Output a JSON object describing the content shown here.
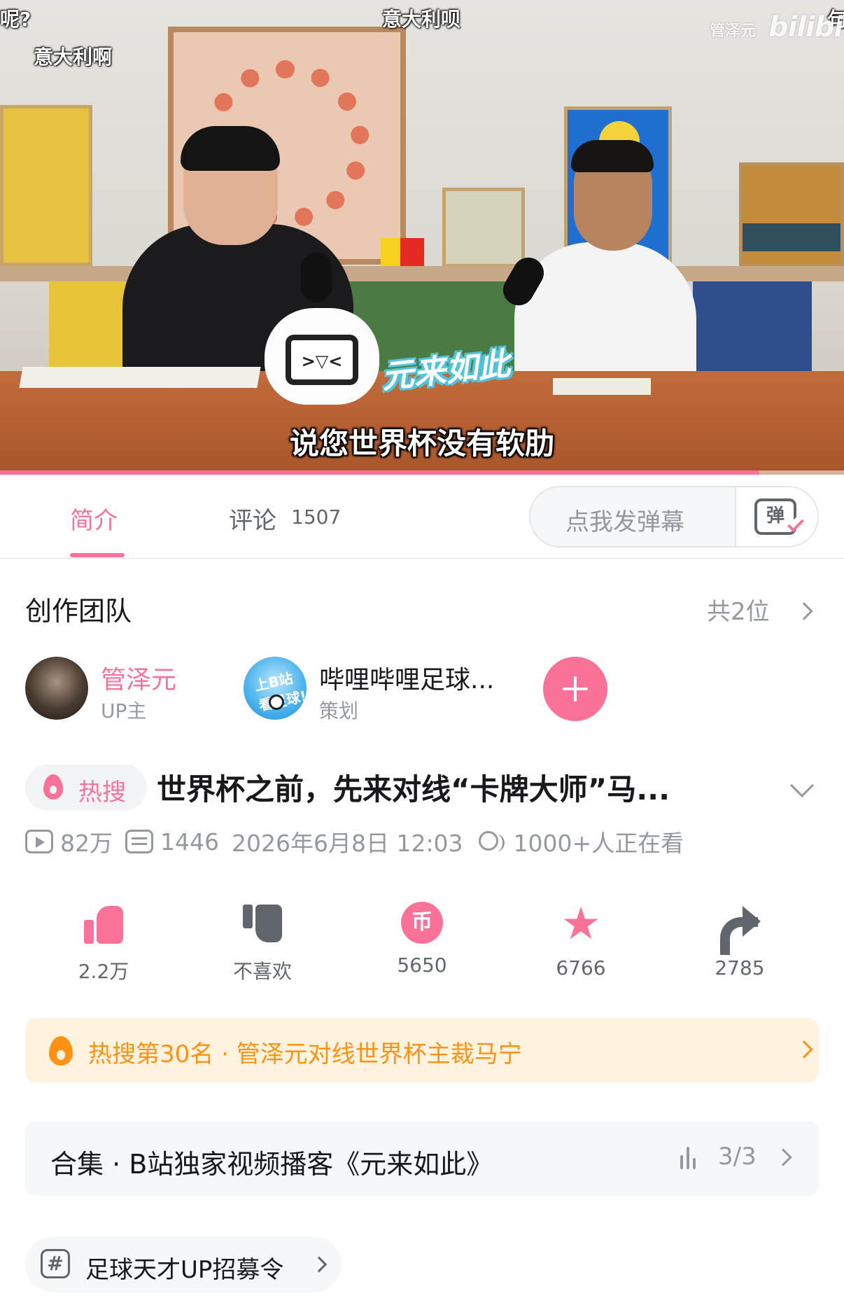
{
  "video": {
    "danmaku": [
      "呢?",
      "意大利呗",
      "意大利啊",
      "句"
    ],
    "subtitle": "说您世界杯没有软肋",
    "watermark_user": "管泽元",
    "watermark_logo": "bilibili",
    "sticker_text": "元来如此",
    "progress": 0.9,
    "colors": {
      "progress": "#fb7299"
    }
  },
  "tabs": {
    "intro_label": "简介",
    "comments_label": "评论",
    "comments_count": "1507",
    "danmaku_placeholder": "点我发弹幕",
    "danmaku_button_icon": "弹"
  },
  "team": {
    "title": "创作团队",
    "count": "共2位",
    "members": [
      {
        "name": "管泽元",
        "role": "UP主"
      },
      {
        "name": "哔哩哔哩足球...",
        "role": "策划",
        "avatar_text": "上B站看足球!"
      }
    ]
  },
  "video_info": {
    "hot_tag": "热搜",
    "title": "世界杯之前，先来对线“卡牌大师”马...",
    "views": "82万",
    "danmaku_count": "1446",
    "date": "2026年6月8日 12:03",
    "watching": "1000+人正在看"
  },
  "actions": {
    "like": "2.2万",
    "dislike": "不喜欢",
    "coin": "5650",
    "coin_icon": "币",
    "favorite": "6766",
    "share": "2785"
  },
  "hot_banner": {
    "text": "热搜第30名 · 管泽元对线世界杯主裁马宁"
  },
  "collection": {
    "title": "合集 · B站独家视频播客《元来如此》",
    "progress": "3/3"
  },
  "topic": {
    "label": "足球天才UP招募令",
    "icon": "#"
  },
  "theme": {
    "pink": "#fb7299",
    "orange": "#ff9212",
    "gray_text": "#9499a0"
  }
}
